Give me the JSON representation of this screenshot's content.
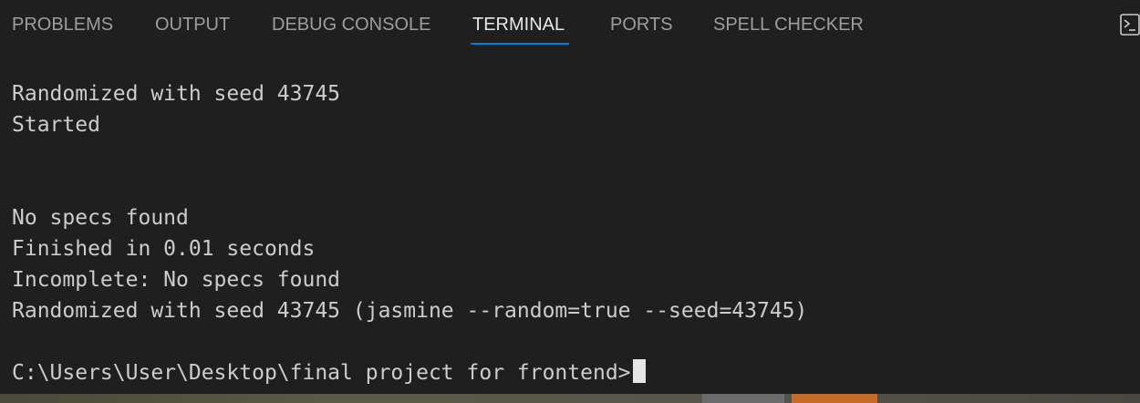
{
  "tabs": [
    {
      "label": "PROBLEMS",
      "active": false
    },
    {
      "label": "OUTPUT",
      "active": false
    },
    {
      "label": "DEBUG CONSOLE",
      "active": false
    },
    {
      "label": "TERMINAL",
      "active": true
    },
    {
      "label": "PORTS",
      "active": false
    },
    {
      "label": "SPELL CHECKER",
      "active": false
    }
  ],
  "terminal": {
    "icon": "terminal-icon",
    "lines": [
      "Randomized with seed 43745",
      "Started",
      "",
      "",
      "No specs found",
      "Finished in 0.01 seconds",
      "Incomplete: No specs found",
      "Randomized with seed 43745 (jasmine --random=true --seed=43745)",
      "",
      "C:\\Users\\User\\Desktop\\final project for frontend>"
    ]
  },
  "colors": {
    "background": "#1f1f1f",
    "tab_inactive": "#9d9d9d",
    "tab_active": "#e7e7e7",
    "active_underline": "#0078d4",
    "terminal_text": "#cccccc"
  }
}
